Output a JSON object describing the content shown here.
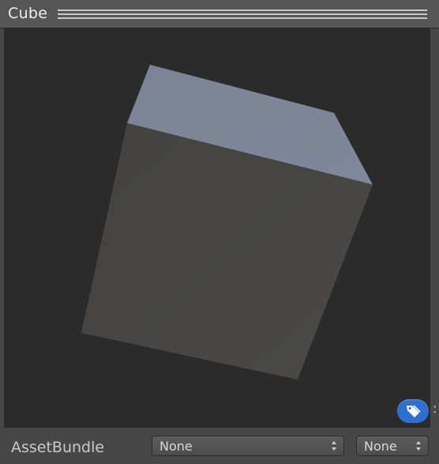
{
  "header": {
    "title": "Cube"
  },
  "footer": {
    "label": "AssetBundle",
    "bundle_name": "None",
    "bundle_variant": "None"
  },
  "colors": {
    "preview_bg": "#2b2b2b",
    "cube_top": "#7b8596",
    "cube_front": "#474644",
    "tag_button": "#2f6fd1"
  },
  "icons": {
    "tag": "tag-icon",
    "stepper": "up-down-arrows-icon"
  }
}
